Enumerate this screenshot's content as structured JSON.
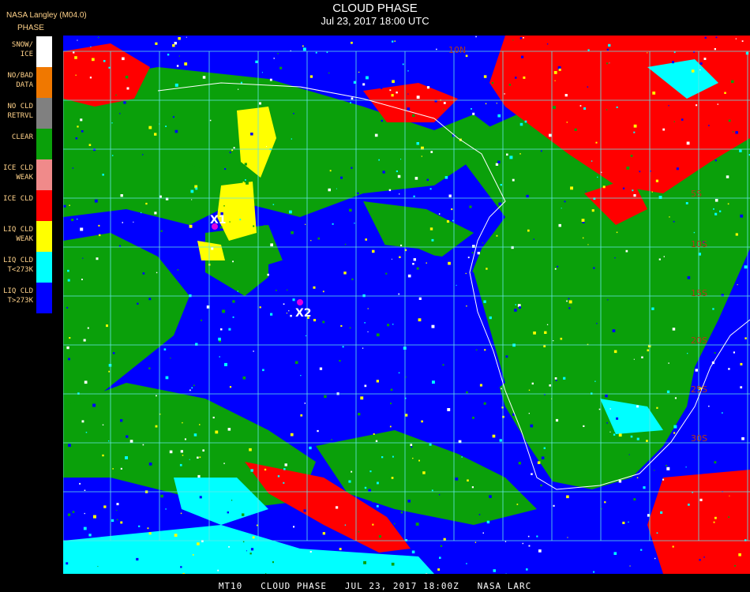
{
  "header": {
    "source": "NASA Langley (M04.0)",
    "product": "PHASE",
    "title": "CLOUD PHASE",
    "subtitle": "Jul 23, 2017 18:00 UTC"
  },
  "legend": [
    {
      "label": "SNOW/\nICE",
      "color": "#ffffff"
    },
    {
      "label": "NO/BAD\nDATA",
      "color": "#f07800"
    },
    {
      "label": "NO CLD\nRETRVL",
      "color": "#808080"
    },
    {
      "label": "CLEAR",
      "color": "#0aa00a"
    },
    {
      "label": "ICE CLD\nWEAK",
      "color": "#f08a8a"
    },
    {
      "label": "ICE CLD",
      "color": "#ff0000"
    },
    {
      "label": "LIQ CLD\nWEAK",
      "color": "#ffff00"
    },
    {
      "label": "LIQ CLD\nT<273K",
      "color": "#00ffff"
    },
    {
      "label": "LIQ CLD\nT>273K",
      "color": "#0000ff"
    }
  ],
  "map": {
    "colors": {
      "ocean_liquid": "#0000ff",
      "clear": "#0aa00a",
      "ice": "#ff0000",
      "liquid_cold": "#00ffff",
      "liquid_weak": "#ffff00",
      "snow": "#ffffff",
      "grid": "#66e6e6",
      "coast": "#ffffff",
      "lat_label": "#b03a1a",
      "marker": "#e000e0"
    },
    "lat_labels": [
      "10N",
      "5S",
      "10S",
      "15S",
      "20S",
      "25S",
      "30S"
    ],
    "markers": [
      {
        "label": "X1"
      },
      {
        "label": "X2"
      }
    ]
  },
  "footer": "MT10   CLOUD PHASE   JUL 23, 2017 18:00Z   NASA LARC"
}
